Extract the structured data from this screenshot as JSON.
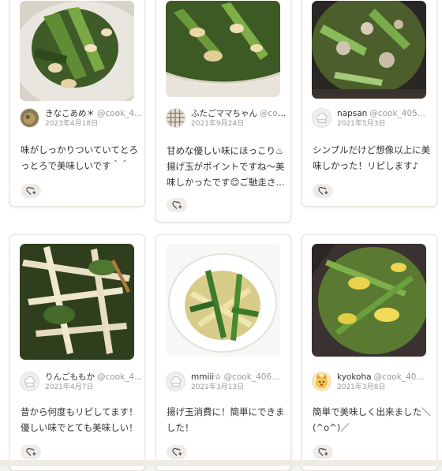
{
  "cards": [
    {
      "name": "きなこあめ＊",
      "handle": "@cook_4...",
      "date": "2023年4月18日",
      "comment": "味がしっかりついていてとろっとろで美味しいです＾＾",
      "avatar_icon": "food-photo-avatar"
    },
    {
      "name": "ふたごママちゃん",
      "handle": "@coo...",
      "date": "2021年9月24日",
      "comment": "甘めな優しい味にほっこり♨揚げ玉がポイントですね〜美味しかったです😊ご馳走さ...",
      "avatar_icon": "plaid-pattern-avatar"
    },
    {
      "name": "napsan",
      "handle": "@cook_405...",
      "date": "2021年5月3日",
      "comment": "シンプルだけど想像以上に美味しかった！リピします♪",
      "avatar_icon": "chef-hat-avatar"
    },
    {
      "name": "りんごももか",
      "handle": "@cook_4...",
      "date": "2021年4月7日",
      "comment": "昔から何度もリピしてます！優しい味でとても美味しい！",
      "avatar_icon": "chef-hat-avatar"
    },
    {
      "name": "mmiii☆",
      "handle": "@cook_406...",
      "date": "2021年3月13日",
      "comment": "揚げ玉消費に！簡単にできました！",
      "avatar_icon": "chef-hat-avatar"
    },
    {
      "name": "kyokoha",
      "handle": "@cook_40...",
      "date": "2021年3月8日",
      "comment": "簡単で美味しく出来ました＼(^o^)／",
      "avatar_icon": "cartoon-character-avatar"
    }
  ],
  "like_icon": "heart-plus-icon",
  "colors": {
    "card_border": "#e6e2dc",
    "like_bg": "#efece8",
    "meta_gray": "#999999"
  }
}
